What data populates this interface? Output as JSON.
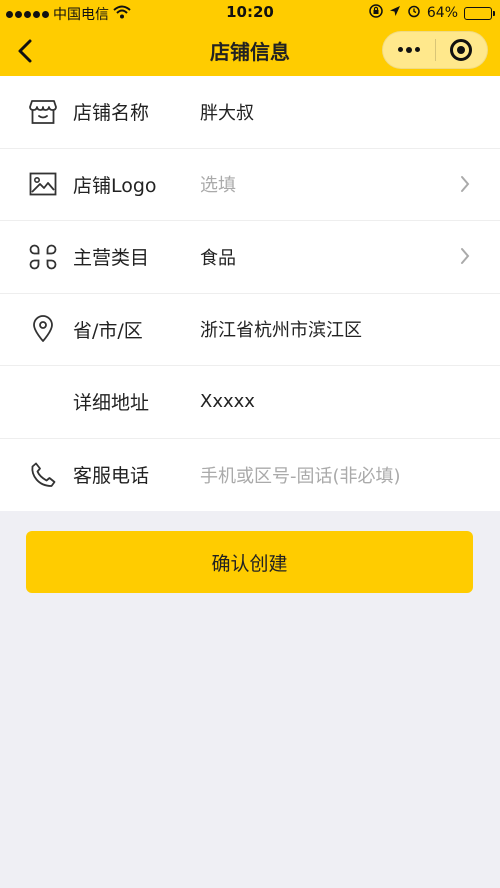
{
  "status_bar": {
    "carrier": "中国电信",
    "time": "10:20",
    "battery": "64%",
    "battery_level": 0.64
  },
  "nav": {
    "title": "店铺信息"
  },
  "form": {
    "rows": [
      {
        "label": "店铺名称",
        "value": "胖大叔",
        "icon": "shop-icon"
      },
      {
        "label": "店铺Logo",
        "placeholder": "选填",
        "icon": "image-icon"
      },
      {
        "label": "主营类目",
        "value": "食品",
        "icon": "category-icon"
      },
      {
        "label": "省/市/区",
        "value": "浙江省杭州市滨江区",
        "icon": "location-icon"
      },
      {
        "label": "详细地址",
        "value": "Xxxxx"
      },
      {
        "label": "客服电话",
        "placeholder": "手机或区号-固话(非必填)",
        "icon": "phone-icon"
      }
    ]
  },
  "confirm_button": "确认创建",
  "colors": {
    "accent": "#ffcc00",
    "background": "#efeff4",
    "placeholder": "#aaaaaa"
  }
}
